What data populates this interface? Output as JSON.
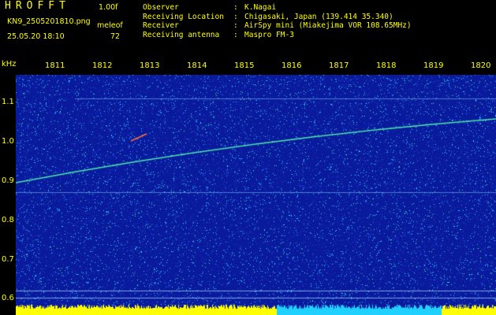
{
  "header": {
    "brand": "HROFFT",
    "version": "1.00f",
    "filename": "KN9_2505201810.png",
    "mode_label": "meleof",
    "datetime": "25.05.20 18:10",
    "mode_value": "72"
  },
  "info": [
    {
      "key": "Observer",
      "value": "K.Nagai"
    },
    {
      "key": "Receiving Location",
      "value": "Chigasaki, Japan (139.414 35.340)"
    },
    {
      "key": "Receiver",
      "value": "AirSpy mini (Miakejima VOR 108.65MHz)"
    },
    {
      "key": "Receiving antenna",
      "value": "Maspro FM-3"
    }
  ],
  "x_axis": {
    "ticks": [
      "1811",
      "1812",
      "1813",
      "1814",
      "1815",
      "1816",
      "1817",
      "1818",
      "1819",
      "1820"
    ]
  },
  "y_axis": {
    "unit": "kHz",
    "ticks": [
      "1.1",
      "1.0",
      "0.9",
      "0.8",
      "0.7",
      "0.6"
    ]
  },
  "colors": {
    "background_blue": "#0a1a9c",
    "noise_cyan": "#28d2ff",
    "noise_green": "#40ff60",
    "text_yellow": "#ffff00",
    "bottom_bar_yellow": "#ffff00",
    "bottom_bar_cyan": "#20d0ff"
  }
}
